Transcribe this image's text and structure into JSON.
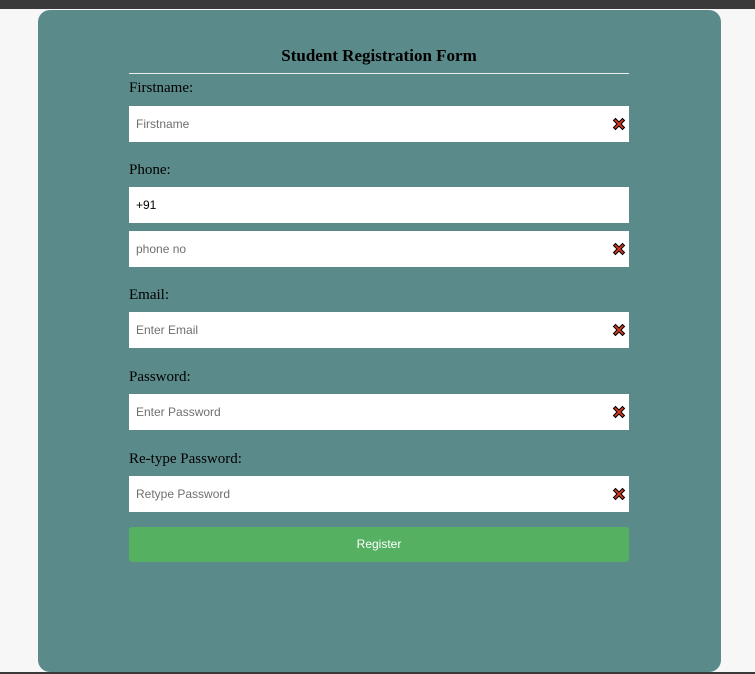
{
  "form": {
    "title": "Student Registration Form",
    "firstname": {
      "label": "Firstname:",
      "placeholder": "Firstname",
      "value": ""
    },
    "phone": {
      "label": "Phone:",
      "country_code": "+91",
      "placeholder": "phone no",
      "value": ""
    },
    "email": {
      "label": "Email:",
      "placeholder": "Enter Email",
      "value": ""
    },
    "password": {
      "label": "Password:",
      "placeholder": "Enter Password",
      "value": ""
    },
    "retype_password": {
      "label": "Re-type Password:",
      "placeholder": "Retype Password",
      "value": ""
    },
    "register_label": "Register"
  },
  "colors": {
    "card_background": "#5a8a89",
    "button_background": "#55b062",
    "error_icon": "#d23a1e"
  },
  "icons": {
    "invalid": "close-icon"
  }
}
